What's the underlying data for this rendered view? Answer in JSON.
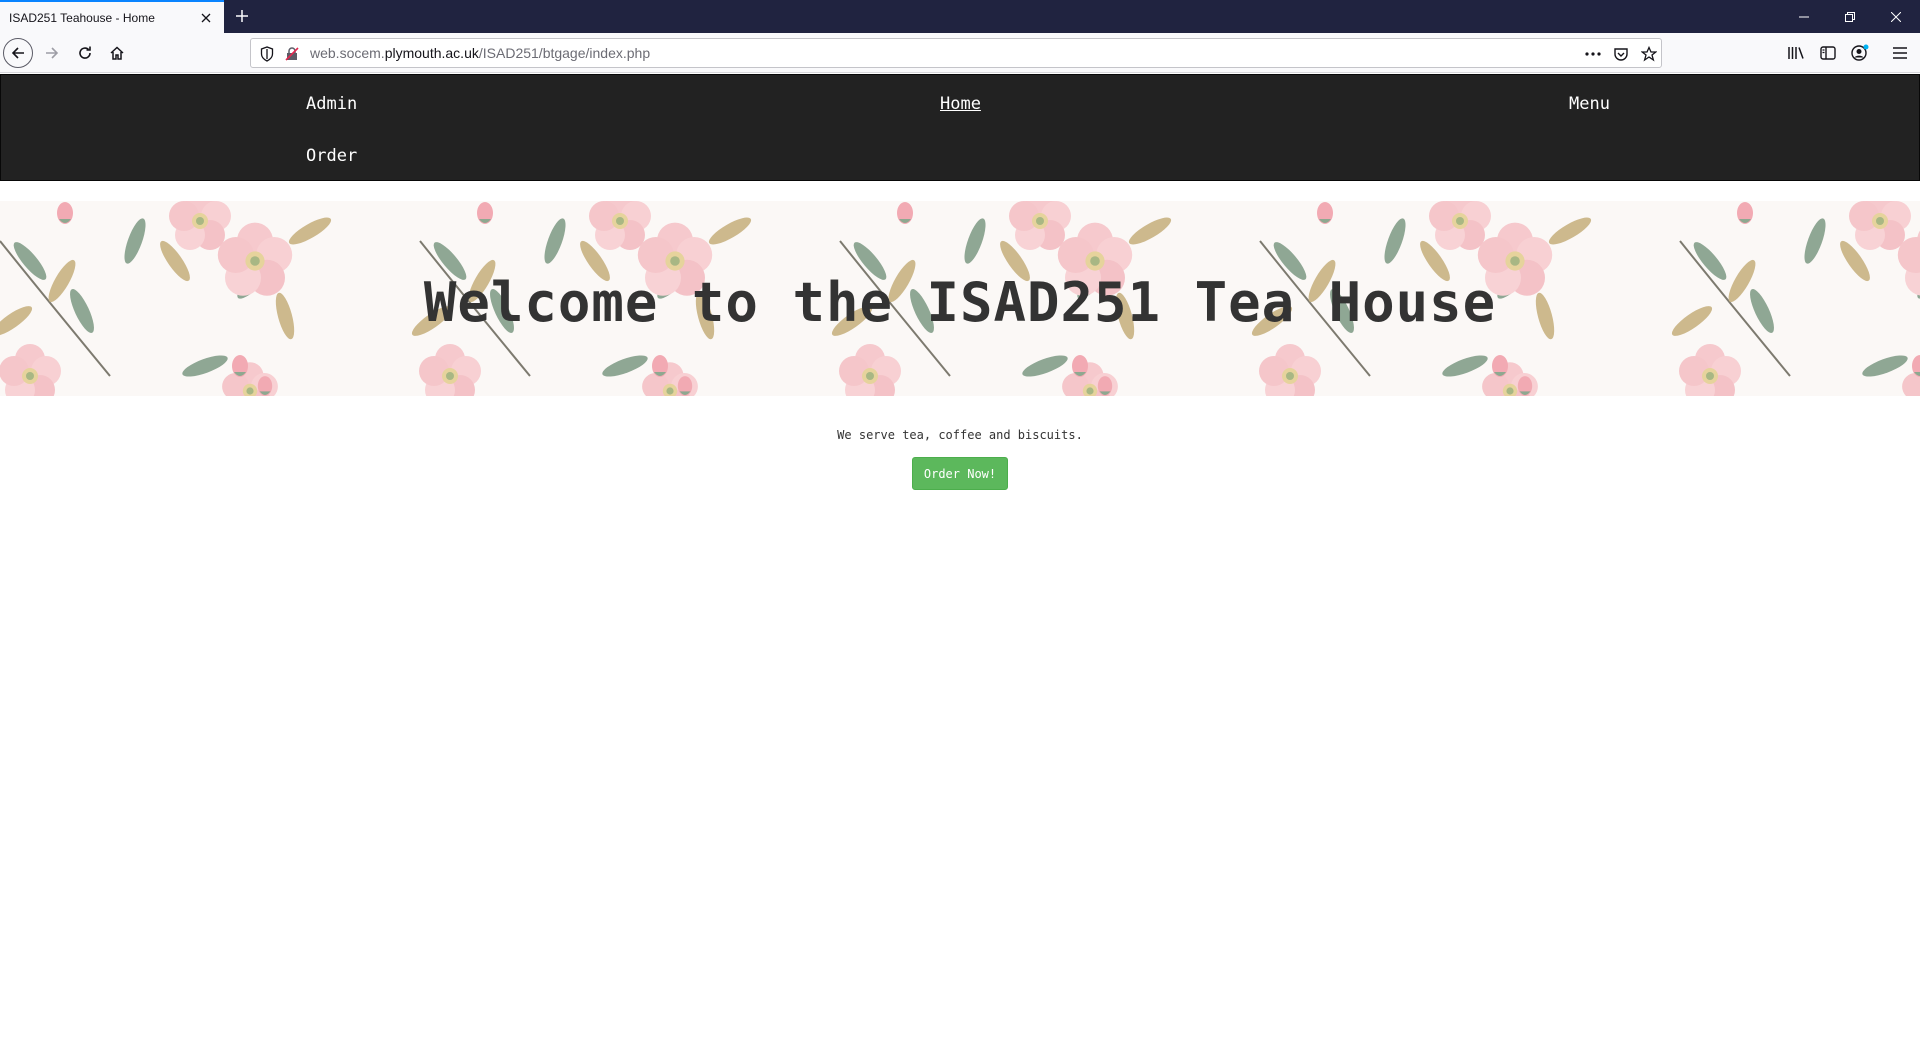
{
  "browser": {
    "tab_title": "ISAD251 Teahouse - Home",
    "url_prefix": "web.socem.",
    "url_domain": "plymouth.ac.uk",
    "url_path": "/ISAD251/btgage/index.php",
    "icons": {
      "back": "back-arrow-icon",
      "forward": "forward-arrow-icon",
      "reload": "reload-icon",
      "home": "home-icon",
      "shield": "shield-icon",
      "insecure": "insecure-lock-icon",
      "more": "more-actions-icon",
      "pocket": "pocket-icon",
      "bookmark": "star-icon",
      "library": "library-icon",
      "sidebar": "sidebar-icon",
      "account": "account-icon",
      "menu": "hamburger-menu-icon"
    },
    "accent_color": "#0a84ff",
    "titlebar_color": "#202340"
  },
  "site": {
    "nav": {
      "admin": "Admin",
      "home": "Home",
      "menu": "Menu",
      "order": "Order"
    },
    "hero_title": "Welcome to the ISAD251 Tea House",
    "tagline": "We serve tea, coffee and biscuits.",
    "order_button": "Order Now!",
    "colors": {
      "nav_bg": "#222222",
      "button_bg": "#5cb85c"
    }
  }
}
